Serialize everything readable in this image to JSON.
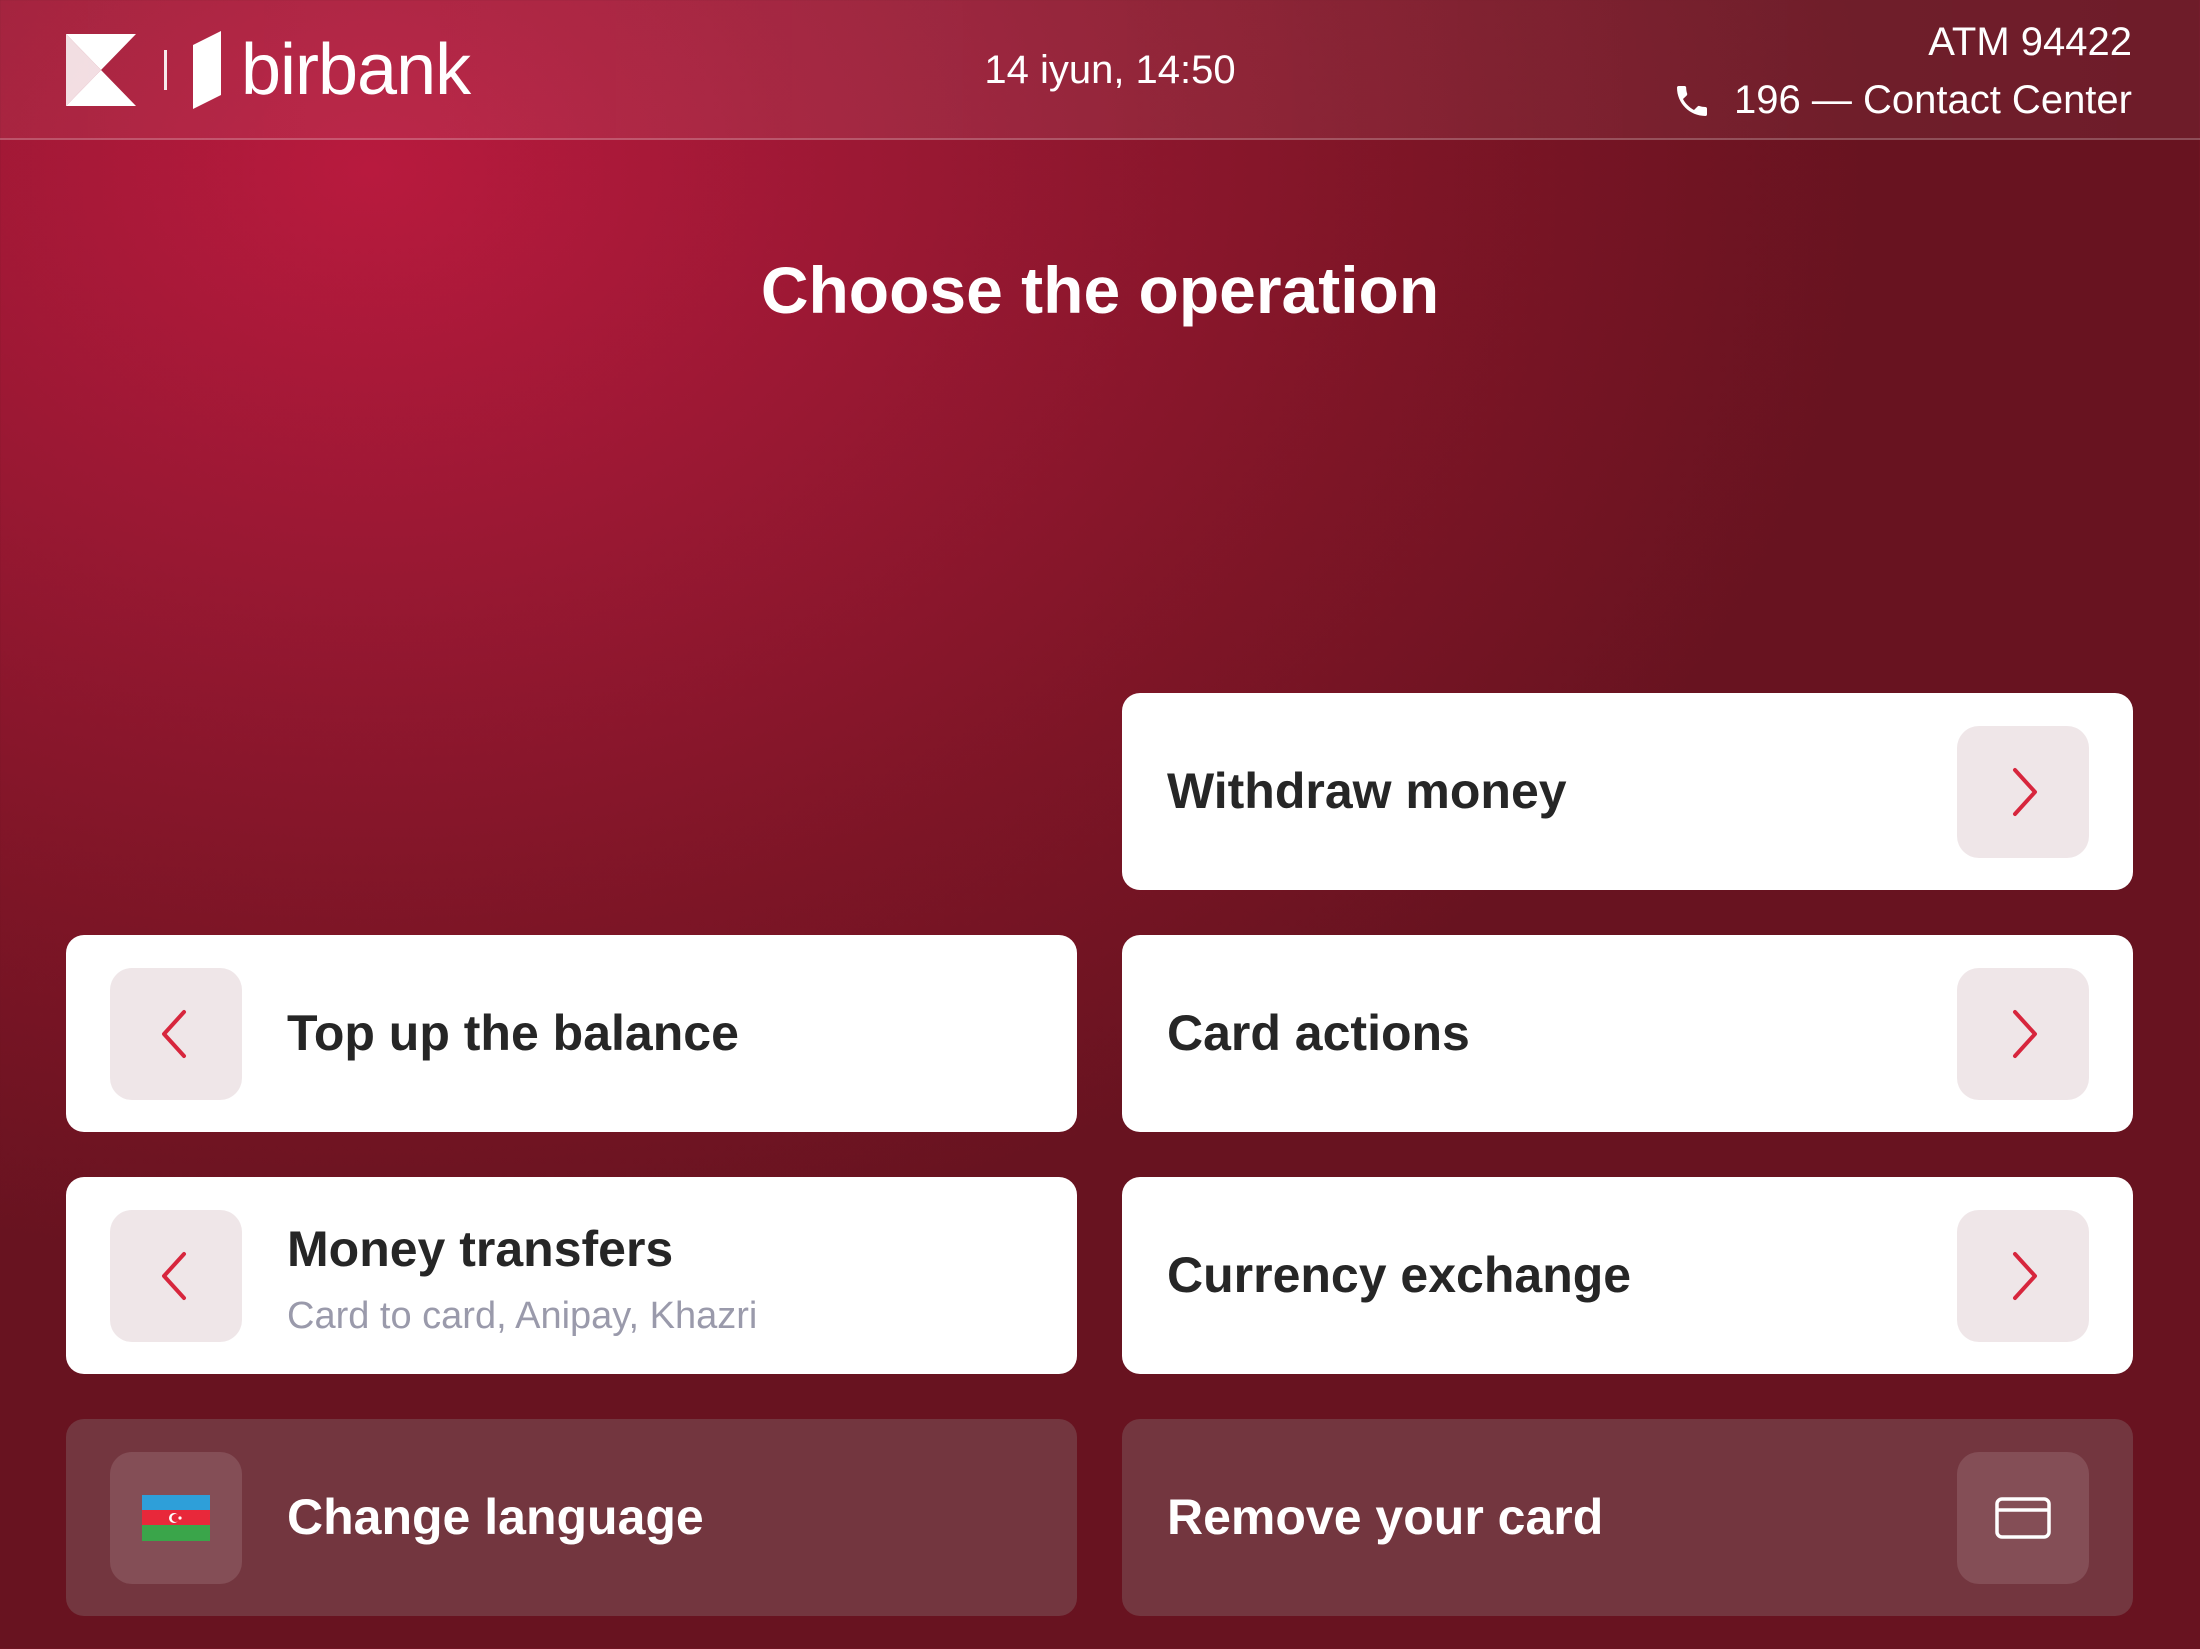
{
  "header": {
    "brand": "birbank",
    "datetime": "14 iyun, 14:50",
    "atm_id": "ATM 94422",
    "contact": "196 — Contact Center"
  },
  "title": "Choose the operation",
  "operations": {
    "withdraw": {
      "label": "Withdraw money",
      "icon": "chevron-right-icon"
    },
    "top_up": {
      "label": "Top up the balance",
      "icon": "chevron-left-icon"
    },
    "card_actions": {
      "label": "Card actions",
      "icon": "chevron-right-icon"
    },
    "transfers": {
      "label": "Money transfers",
      "subtitle": "Card to card, Anipay, Khazri",
      "icon": "chevron-left-icon"
    },
    "exchange": {
      "label": "Currency exchange",
      "icon": "chevron-right-icon"
    },
    "language": {
      "label": "Change language",
      "icon": "azerbaijan-flag-icon"
    },
    "remove_card": {
      "label": "Remove your card",
      "icon": "card-icon"
    }
  },
  "colors": {
    "background": "#9a1833",
    "accent": "#d7263d",
    "button_bg": "#efe6e8",
    "text_dark": "#262626",
    "subtitle": "#9a9aab"
  }
}
